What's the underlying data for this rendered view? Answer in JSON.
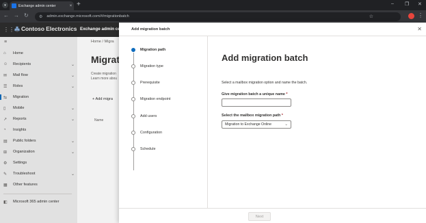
{
  "browser": {
    "tab_title": "Exchange admin center",
    "tab_close": "×",
    "new_tab": "+",
    "url": "admin.exchange.microsoft.com/#/migrationbatch",
    "minimize": "–",
    "restore": "❐",
    "close": "✕"
  },
  "app": {
    "brand": "Contoso Electronics",
    "app_name": "Exchange admin ce"
  },
  "nav": {
    "items": [
      {
        "icon": "⌂",
        "label": "Home",
        "chevron": ""
      },
      {
        "icon": "☺",
        "label": "Recipients",
        "chevron": "⌄"
      },
      {
        "icon": "✉",
        "label": "Mail flow",
        "chevron": "⌄"
      },
      {
        "icon": "☰",
        "label": "Roles",
        "chevron": "⌄"
      },
      {
        "icon": "⇆",
        "label": "Migration",
        "chevron": ""
      },
      {
        "icon": "▯",
        "label": "Mobile",
        "chevron": "⌄"
      },
      {
        "icon": "↗",
        "label": "Reports",
        "chevron": "⌄"
      },
      {
        "icon": "◔",
        "label": "Insights",
        "chevron": ""
      },
      {
        "icon": "▤",
        "label": "Public folders",
        "chevron": "⌄"
      },
      {
        "icon": "⊞",
        "label": "Organization",
        "chevron": "⌄"
      },
      {
        "icon": "⚙",
        "label": "Settings",
        "chevron": ""
      },
      {
        "icon": "✎",
        "label": "Troubleshoot",
        "chevron": "⌄"
      },
      {
        "icon": "▦",
        "label": "Other features",
        "chevron": ""
      }
    ],
    "admin_center": "Microsoft 365 admin center"
  },
  "page": {
    "breadcrumb": "Home  /  Migra",
    "title": "Migratio",
    "desc_line1": "Create migration",
    "desc_line2": "Learn more abou",
    "action": "Add migra",
    "col_name": "Name"
  },
  "panel": {
    "title": "Add migration batch",
    "close": "✕",
    "heading": "Add migration batch",
    "intro": "Select a mailbox migration option and name the batch.",
    "name_label": "Give migration batch a unique name",
    "name_value": "",
    "path_label": "Select the mailbox migration path",
    "path_value": "Migration to Exchange Online",
    "required_mark": "*",
    "next_label": "Next",
    "steps": [
      "Migration path",
      "Migration type",
      "Prerequisite",
      "Migration endpoint",
      "Add users",
      "Configuration",
      "Schedule"
    ]
  }
}
